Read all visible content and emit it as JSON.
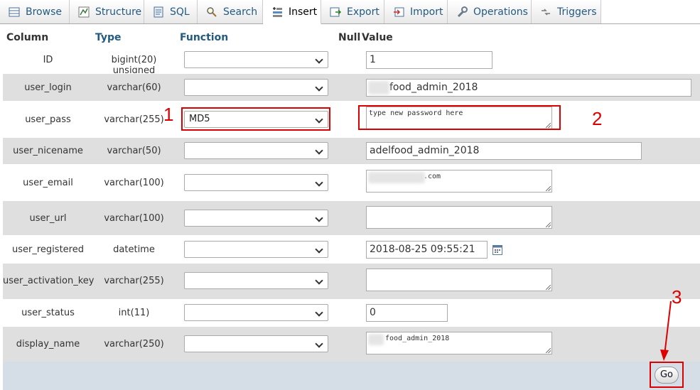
{
  "tabs": [
    {
      "label": "Browse",
      "icon": "browse-icon"
    },
    {
      "label": "Structure",
      "icon": "structure-icon"
    },
    {
      "label": "SQL",
      "icon": "sql-icon"
    },
    {
      "label": "Search",
      "icon": "search-icon"
    },
    {
      "label": "Insert",
      "icon": "insert-icon",
      "active": true
    },
    {
      "label": "Export",
      "icon": "export-icon"
    },
    {
      "label": "Import",
      "icon": "import-icon"
    },
    {
      "label": "Operations",
      "icon": "operations-icon"
    },
    {
      "label": "Triggers",
      "icon": "triggers-icon"
    }
  ],
  "header": {
    "column": "Column",
    "type": "Type",
    "function": "Function",
    "null": "Null",
    "value": "Value"
  },
  "rows": [
    {
      "column": "ID",
      "type": "bigint(20) unsigned",
      "function": "",
      "value": "1"
    },
    {
      "column": "user_login",
      "type": "varchar(60)",
      "function": "",
      "value": "food_admin_2018"
    },
    {
      "column": "user_pass",
      "type": "varchar(255)",
      "function": "MD5",
      "value": "type new password here"
    },
    {
      "column": "user_nicename",
      "type": "varchar(50)",
      "function": "",
      "value": "adelfood_admin_2018"
    },
    {
      "column": "user_email",
      "type": "varchar(100)",
      "function": "",
      "value": ".com"
    },
    {
      "column": "user_url",
      "type": "varchar(100)",
      "function": "",
      "value": ""
    },
    {
      "column": "user_registered",
      "type": "datetime",
      "function": "",
      "value": "2018-08-25 09:55:21"
    },
    {
      "column": "user_activation_key",
      "type": "varchar(255)",
      "function": "",
      "value": ""
    },
    {
      "column": "user_status",
      "type": "int(11)",
      "function": "",
      "value": "0"
    },
    {
      "column": "display_name",
      "type": "varchar(250)",
      "function": "",
      "value": "food_admin_2018"
    }
  ],
  "annotations": {
    "one": "1",
    "two": "2",
    "three": "3",
    "color": "#dd0000"
  },
  "go_label": "Go"
}
